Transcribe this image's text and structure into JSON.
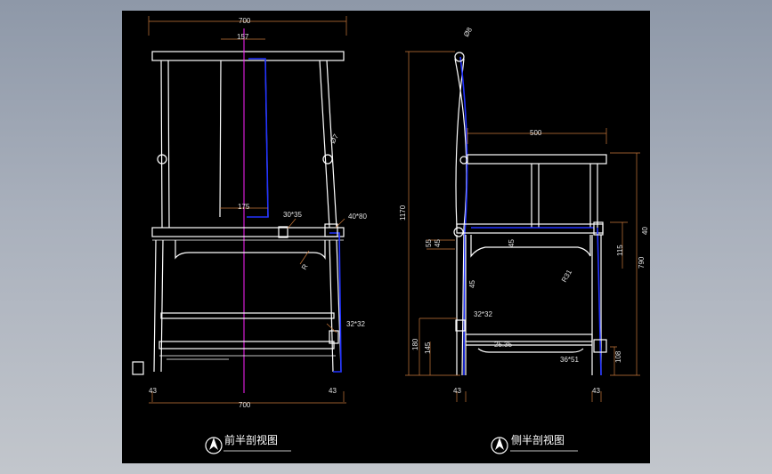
{
  "front_view": {
    "title": "前半剖视图",
    "dims": {
      "top_width": "700",
      "back_splat": "157",
      "splat_bottom": "175",
      "joint_a": "30*35",
      "joint_b": "40*80",
      "angle": "Ø7",
      "joint_c": "32*32",
      "r_label": "R",
      "leg_left": "43",
      "leg_right": "43",
      "bottom_width": "700"
    }
  },
  "side_view": {
    "title": "侧半剖视图",
    "dims": {
      "top_circle": "Ø8",
      "total_height": "1170",
      "seat_depth": "500",
      "rail_a": "55",
      "rail_b": "45",
      "slat_angle": "45",
      "rail_c": "45",
      "seat_right_40": "40",
      "seat_right_115": "115",
      "seat_height": "790",
      "radius": "R31",
      "joint_d": "32*32",
      "stretcher_180": "180",
      "stretcher_145": "145",
      "stretcher_mid": "25.35",
      "joint_e": "36*51",
      "foot_108": "108",
      "leg_left": "43",
      "leg_right": "43"
    }
  },
  "colors": {
    "background": "#000000",
    "outline": "#ffffff",
    "dimension": "#c8783a",
    "section": "#2233ff",
    "centerline": "#ff22ff"
  }
}
